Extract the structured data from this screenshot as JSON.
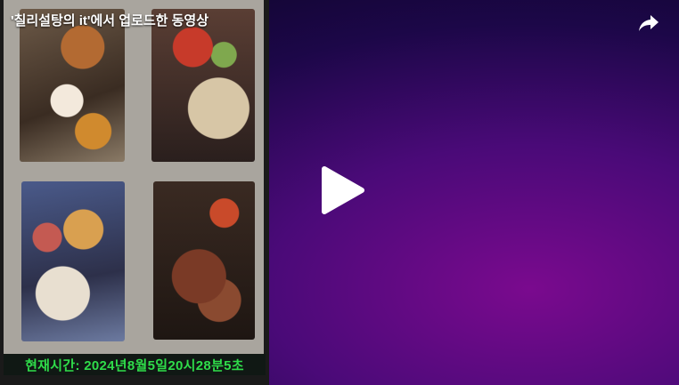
{
  "video": {
    "title": "'칠리설탕의 it'에서 업로드한 동영상",
    "timestamp_text": "현재시간: 2024년8월5일20시28분5초"
  },
  "controls": {
    "share_icon": "share-arrow-icon",
    "play_icon": "play-icon"
  },
  "colors": {
    "timestamp_green": "#2fdc4a",
    "background_purple": "#4a0a78",
    "accent_magenta": "#7a0a8e"
  }
}
